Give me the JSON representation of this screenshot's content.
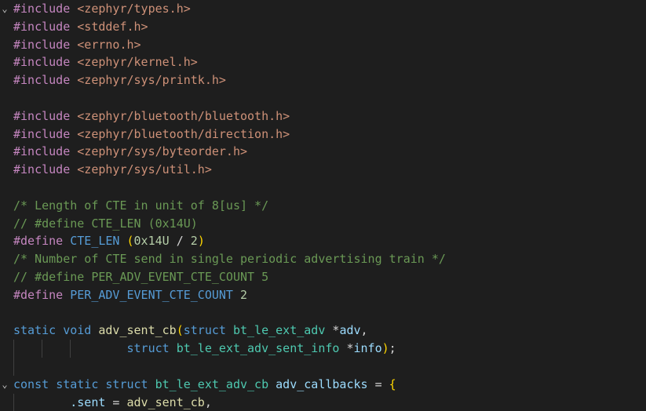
{
  "editor": {
    "fold_glyph": "⌄",
    "lines": [
      {
        "fold": true,
        "tokens": [
          {
            "t": "#include",
            "c": "pp"
          },
          {
            "t": " ",
            "c": "punc"
          },
          {
            "t": "<zephyr/types.h>",
            "c": "str"
          }
        ]
      },
      {
        "tokens": [
          {
            "t": "#include",
            "c": "pp"
          },
          {
            "t": " ",
            "c": "punc"
          },
          {
            "t": "<stddef.h>",
            "c": "str"
          }
        ]
      },
      {
        "tokens": [
          {
            "t": "#include",
            "c": "pp"
          },
          {
            "t": " ",
            "c": "punc"
          },
          {
            "t": "<errno.h>",
            "c": "str"
          }
        ]
      },
      {
        "tokens": [
          {
            "t": "#include",
            "c": "pp"
          },
          {
            "t": " ",
            "c": "punc"
          },
          {
            "t": "<zephyr/kernel.h>",
            "c": "str"
          }
        ]
      },
      {
        "tokens": [
          {
            "t": "#include",
            "c": "pp"
          },
          {
            "t": " ",
            "c": "punc"
          },
          {
            "t": "<zephyr/sys/printk.h>",
            "c": "str"
          }
        ]
      },
      {
        "tokens": []
      },
      {
        "tokens": [
          {
            "t": "#include",
            "c": "pp"
          },
          {
            "t": " ",
            "c": "punc"
          },
          {
            "t": "<zephyr/bluetooth/bluetooth.h>",
            "c": "str"
          }
        ]
      },
      {
        "tokens": [
          {
            "t": "#include",
            "c": "pp"
          },
          {
            "t": " ",
            "c": "punc"
          },
          {
            "t": "<zephyr/bluetooth/direction.h>",
            "c": "str"
          }
        ]
      },
      {
        "tokens": [
          {
            "t": "#include",
            "c": "pp"
          },
          {
            "t": " ",
            "c": "punc"
          },
          {
            "t": "<zephyr/sys/byteorder.h>",
            "c": "str"
          }
        ]
      },
      {
        "tokens": [
          {
            "t": "#include",
            "c": "pp"
          },
          {
            "t": " ",
            "c": "punc"
          },
          {
            "t": "<zephyr/sys/util.h>",
            "c": "str"
          }
        ]
      },
      {
        "tokens": []
      },
      {
        "tokens": [
          {
            "t": "/* Length of CTE in unit of 8[us] */",
            "c": "cm"
          }
        ]
      },
      {
        "tokens": [
          {
            "t": "// #define CTE_LEN (0x14U)",
            "c": "cm"
          }
        ]
      },
      {
        "tokens": [
          {
            "t": "#define",
            "c": "pp"
          },
          {
            "t": " ",
            "c": "punc"
          },
          {
            "t": "CTE_LEN",
            "c": "macro"
          },
          {
            "t": " ",
            "c": "punc"
          },
          {
            "t": "(",
            "c": "brace"
          },
          {
            "t": "0x14U",
            "c": "num"
          },
          {
            "t": " / ",
            "c": "punc"
          },
          {
            "t": "2",
            "c": "num"
          },
          {
            "t": ")",
            "c": "brace"
          }
        ]
      },
      {
        "tokens": [
          {
            "t": "/* Number of CTE send in single periodic advertising train */",
            "c": "cm"
          }
        ]
      },
      {
        "tokens": [
          {
            "t": "// #define PER_ADV_EVENT_CTE_COUNT 5",
            "c": "cm"
          }
        ]
      },
      {
        "tokens": [
          {
            "t": "#define",
            "c": "pp"
          },
          {
            "t": " ",
            "c": "punc"
          },
          {
            "t": "PER_ADV_EVENT_CTE_COUNT",
            "c": "macro"
          },
          {
            "t": " ",
            "c": "punc"
          },
          {
            "t": "2",
            "c": "num"
          }
        ]
      },
      {
        "tokens": []
      },
      {
        "tokens": [
          {
            "t": "static",
            "c": "kw"
          },
          {
            "t": " ",
            "c": "punc"
          },
          {
            "t": "void",
            "c": "kw"
          },
          {
            "t": " ",
            "c": "punc"
          },
          {
            "t": "adv_sent_cb",
            "c": "fn"
          },
          {
            "t": "(",
            "c": "brace"
          },
          {
            "t": "struct",
            "c": "kw"
          },
          {
            "t": " ",
            "c": "punc"
          },
          {
            "t": "bt_le_ext_adv",
            "c": "type"
          },
          {
            "t": " *",
            "c": "punc"
          },
          {
            "t": "adv",
            "c": "var"
          },
          {
            "t": ",",
            "c": "punc"
          }
        ]
      },
      {
        "guides": 3,
        "tokens": [
          {
            "t": "                ",
            "c": "punc"
          },
          {
            "t": "struct",
            "c": "kw"
          },
          {
            "t": " ",
            "c": "punc"
          },
          {
            "t": "bt_le_ext_adv_sent_info",
            "c": "type"
          },
          {
            "t": " *",
            "c": "punc"
          },
          {
            "t": "info",
            "c": "var"
          },
          {
            "t": ")",
            "c": "brace"
          },
          {
            "t": ";",
            "c": "punc"
          }
        ]
      },
      {
        "guides": 1,
        "tokens": []
      },
      {
        "fold": true,
        "tokens": [
          {
            "t": "const",
            "c": "kw"
          },
          {
            "t": " ",
            "c": "punc"
          },
          {
            "t": "static",
            "c": "kw"
          },
          {
            "t": " ",
            "c": "punc"
          },
          {
            "t": "struct",
            "c": "kw"
          },
          {
            "t": " ",
            "c": "punc"
          },
          {
            "t": "bt_le_ext_adv_cb",
            "c": "type"
          },
          {
            "t": " ",
            "c": "punc"
          },
          {
            "t": "adv_callbacks",
            "c": "var"
          },
          {
            "t": " = ",
            "c": "punc"
          },
          {
            "t": "{",
            "c": "brace"
          }
        ]
      },
      {
        "guides": 1,
        "tokens": [
          {
            "t": "        ",
            "c": "punc"
          },
          {
            "t": ".sent",
            "c": "var"
          },
          {
            "t": " = ",
            "c": "punc"
          },
          {
            "t": "adv_sent_cb",
            "c": "fn"
          },
          {
            "t": ",",
            "c": "punc"
          }
        ]
      }
    ]
  }
}
